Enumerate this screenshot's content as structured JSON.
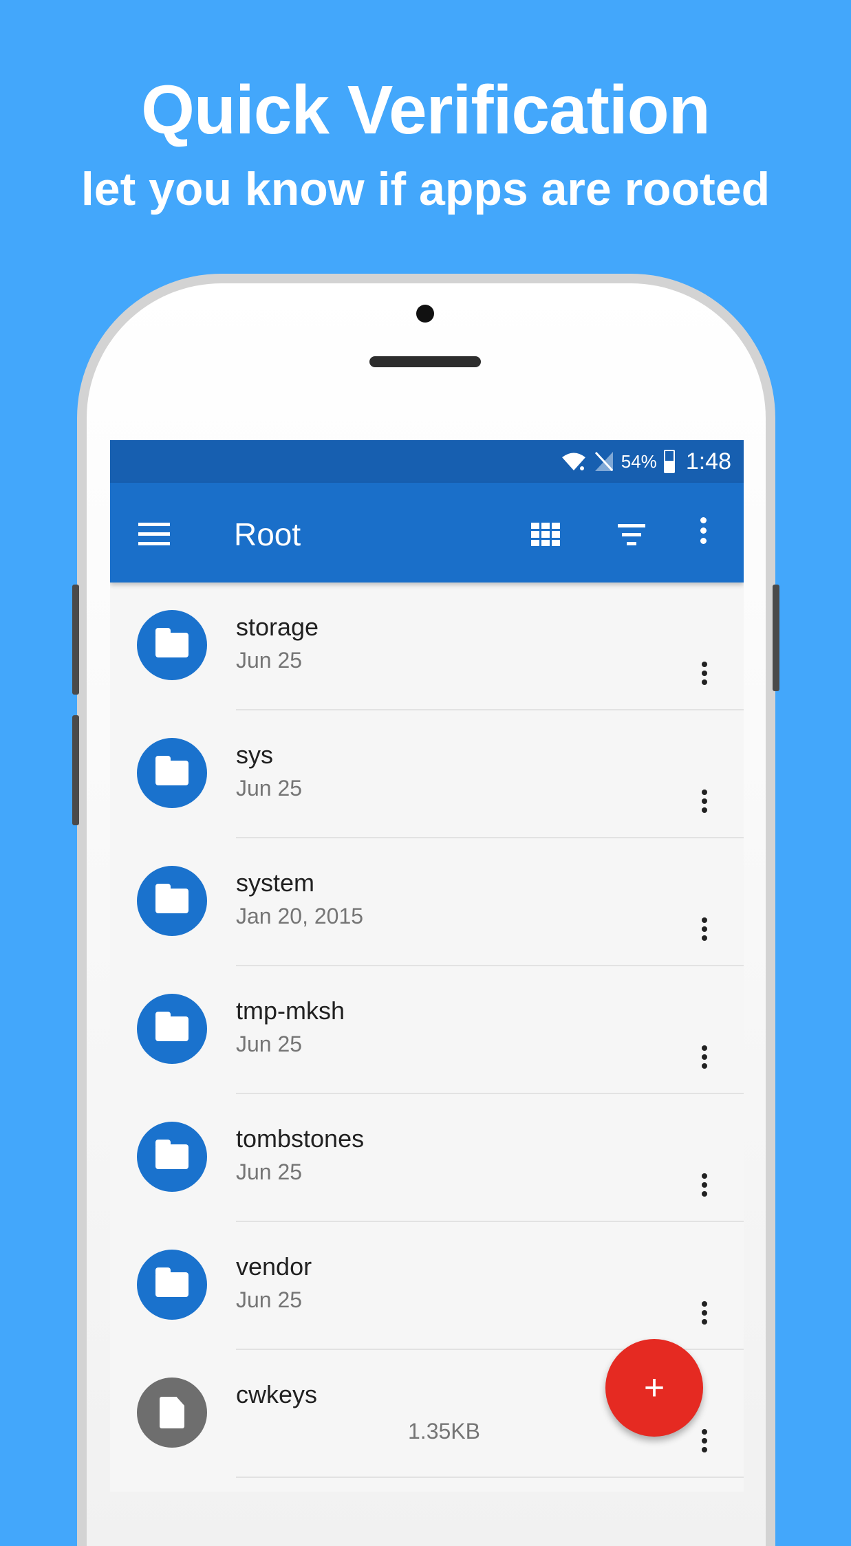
{
  "promo": {
    "title": "Quick Verification",
    "subtitle": "let you know if apps are rooted"
  },
  "status_bar": {
    "battery": "54%",
    "time": "1:48",
    "battery_level_pct": 54,
    "icons": [
      "wifi-icon",
      "no-sim-icon",
      "battery-icon"
    ]
  },
  "app_bar": {
    "title": "Root",
    "icons": [
      "menu-icon",
      "grid-view-icon",
      "filter-icon",
      "overflow-menu-icon"
    ]
  },
  "files": [
    {
      "name": "storage",
      "meta": "Jun 25",
      "type": "folder"
    },
    {
      "name": "sys",
      "meta": "Jun 25",
      "type": "folder"
    },
    {
      "name": "system",
      "meta": "Jan 20, 2015",
      "type": "folder"
    },
    {
      "name": "tmp-mksh",
      "meta": "Jun 25",
      "type": "folder"
    },
    {
      "name": "tombstones",
      "meta": "Jun 25",
      "type": "folder"
    },
    {
      "name": "vendor",
      "meta": "Jun 25",
      "type": "folder"
    },
    {
      "name": "cwkeys",
      "size": "1.35KB",
      "type": "file"
    }
  ],
  "fab": {
    "label": "+"
  },
  "colors": {
    "background": "#43a7fb",
    "status_bar": "#175fb0",
    "app_bar": "#1a6fc9",
    "folder_icon": "#1a72cd",
    "file_icon": "#6e6e6e",
    "fab": "#e52a22"
  }
}
